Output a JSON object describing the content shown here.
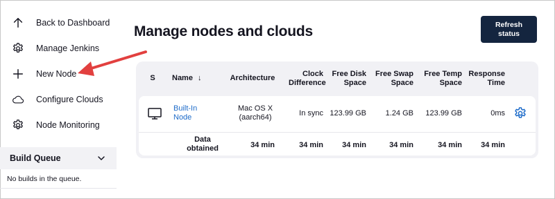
{
  "sidebar": {
    "items": [
      {
        "label": "Back to Dashboard",
        "icon": "arrow-up-icon"
      },
      {
        "label": "Manage Jenkins",
        "icon": "gear-icon"
      },
      {
        "label": "New Node",
        "icon": "plus-icon"
      },
      {
        "label": "Configure Clouds",
        "icon": "cloud-icon"
      },
      {
        "label": "Node Monitoring",
        "icon": "gear-icon"
      }
    ],
    "build_queue": {
      "title": "Build Queue",
      "empty_text": "No builds in the queue."
    }
  },
  "header": {
    "title": "Manage nodes and clouds",
    "refresh_button": "Refresh status"
  },
  "table": {
    "columns": {
      "s": "S",
      "name": "Name",
      "name_sort": "↓",
      "architecture": "Architecture",
      "clock_difference": "Clock Difference",
      "free_disk_space": "Free Disk Space",
      "free_swap_space": "Free Swap Space",
      "free_temp_space": "Free Temp Space",
      "response_time": "Response Time"
    },
    "node_row": {
      "name": "Built-In Node",
      "architecture": "Mac OS X (aarch64)",
      "clock_difference": "In sync",
      "free_disk_space": "123.99 GB",
      "free_swap_space": "1.24 GB",
      "free_temp_space": "123.99 GB",
      "response_time": "0ms"
    },
    "data_obtained_row": {
      "label": "Data obtained",
      "architecture": "34 min",
      "clock_difference": "34 min",
      "free_disk_space": "34 min",
      "free_swap_space": "34 min",
      "free_temp_space": "34 min",
      "response_time": "34 min"
    }
  },
  "colors": {
    "accent": "#14253f",
    "link": "#1d6bc9",
    "annotation_arrow": "#e2403f",
    "table_bg": "#f1f1f5"
  }
}
